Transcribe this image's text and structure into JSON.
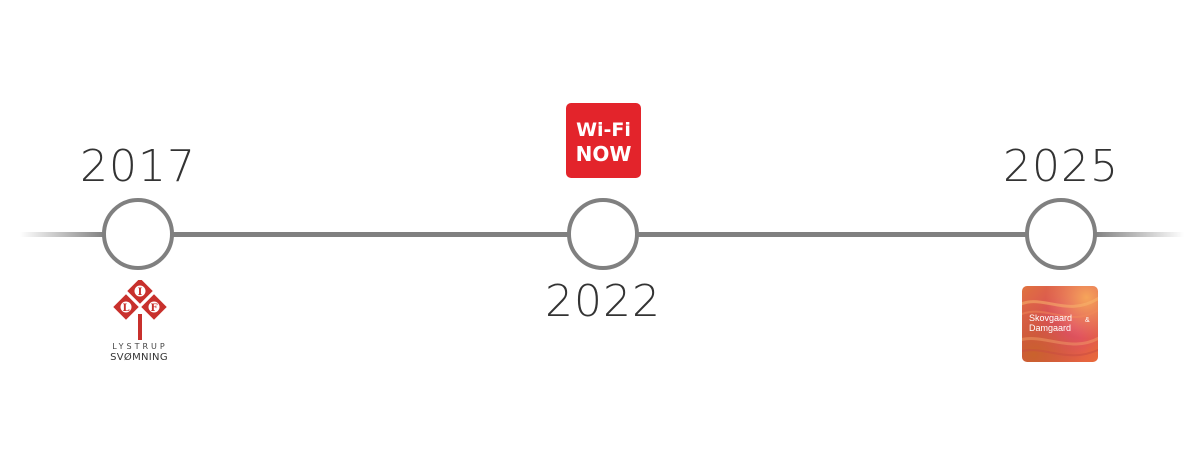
{
  "timeline": {
    "events": [
      {
        "year": "2017",
        "logo": {
          "name": "lystrup-svomning-logo",
          "letters": [
            "L",
            "I",
            "F"
          ],
          "line1": "LYSTRUP",
          "line2": "SVØMNING",
          "color": "#c8302c"
        }
      },
      {
        "year": "2022",
        "logo": {
          "name": "wifi-now-logo",
          "line1": "Wi-Fi",
          "line2": "NOW",
          "color": "#e3242b"
        }
      },
      {
        "year": "2025",
        "logo": {
          "name": "skovgaard-damgaard-logo",
          "line1": "Skovgaard",
          "line2": "Damgaard",
          "amp": "&"
        }
      }
    ],
    "line_color": "#808080",
    "year_color": "#333333"
  }
}
